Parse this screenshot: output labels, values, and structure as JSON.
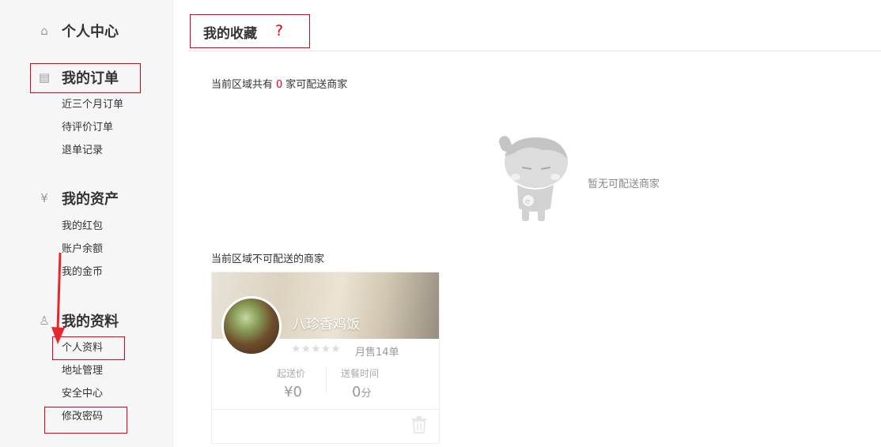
{
  "sidebar": {
    "sections": [
      {
        "icon": "home-icon",
        "glyph": "⌂",
        "title": "个人中心",
        "items": []
      },
      {
        "icon": "order-icon",
        "glyph": "▤",
        "title": "我的订单",
        "items": [
          "近三个月订单",
          "待评价订单",
          "退单记录"
        ]
      },
      {
        "icon": "yen-icon",
        "glyph": "¥",
        "title": "我的资产",
        "items": [
          "我的红包",
          "账户余额",
          "我的金币"
        ]
      },
      {
        "icon": "user-icon",
        "glyph": "♙",
        "title": "我的资料",
        "items": [
          "个人资料",
          "地址管理",
          "安全中心",
          "修改密码"
        ]
      }
    ]
  },
  "main": {
    "title": "我的收藏",
    "help": "?",
    "available": {
      "prefix": "当前区域共有",
      "count": "0",
      "suffix": "家可配送商家"
    },
    "empty_text": "暂无可配送商家",
    "unavailable_label": "当前区域不可配送的商家",
    "shop": {
      "name": "八珍香鸡饭",
      "stars": "★★★★★",
      "sales": "月售14单",
      "min_order_label": "起送价",
      "min_order_value": "¥0",
      "delivery_time_label": "送餐时间",
      "delivery_time_value": "0",
      "delivery_time_unit": "分"
    }
  },
  "colors": {
    "accent": "#e60012",
    "sidebar_bg": "#f6f6f6"
  }
}
